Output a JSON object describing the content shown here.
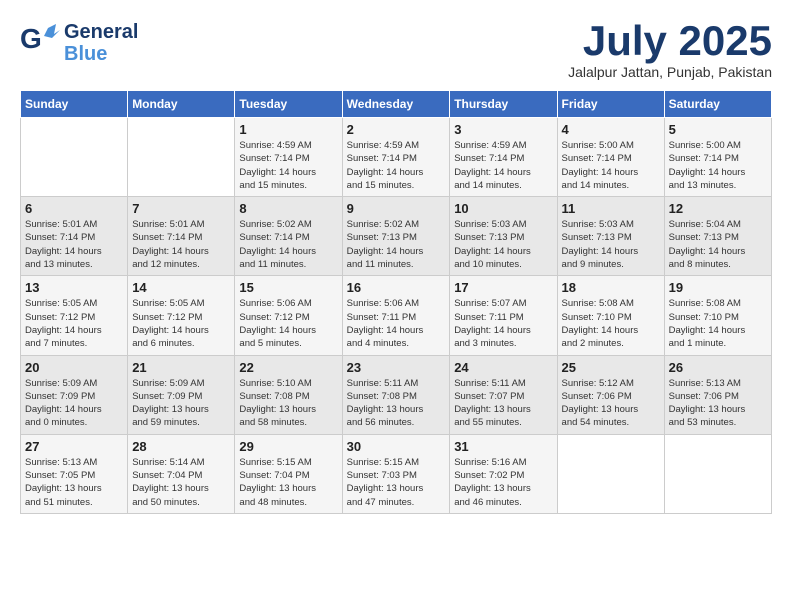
{
  "header": {
    "logo_general": "General",
    "logo_blue": "Blue",
    "month_title": "July 2025",
    "location": "Jalalpur Jattan, Punjab, Pakistan"
  },
  "weekdays": [
    "Sunday",
    "Monday",
    "Tuesday",
    "Wednesday",
    "Thursday",
    "Friday",
    "Saturday"
  ],
  "weeks": [
    [
      {
        "day": "",
        "info": ""
      },
      {
        "day": "",
        "info": ""
      },
      {
        "day": "1",
        "info": "Sunrise: 4:59 AM\nSunset: 7:14 PM\nDaylight: 14 hours\nand 15 minutes."
      },
      {
        "day": "2",
        "info": "Sunrise: 4:59 AM\nSunset: 7:14 PM\nDaylight: 14 hours\nand 15 minutes."
      },
      {
        "day": "3",
        "info": "Sunrise: 4:59 AM\nSunset: 7:14 PM\nDaylight: 14 hours\nand 14 minutes."
      },
      {
        "day": "4",
        "info": "Sunrise: 5:00 AM\nSunset: 7:14 PM\nDaylight: 14 hours\nand 14 minutes."
      },
      {
        "day": "5",
        "info": "Sunrise: 5:00 AM\nSunset: 7:14 PM\nDaylight: 14 hours\nand 13 minutes."
      }
    ],
    [
      {
        "day": "6",
        "info": "Sunrise: 5:01 AM\nSunset: 7:14 PM\nDaylight: 14 hours\nand 13 minutes."
      },
      {
        "day": "7",
        "info": "Sunrise: 5:01 AM\nSunset: 7:14 PM\nDaylight: 14 hours\nand 12 minutes."
      },
      {
        "day": "8",
        "info": "Sunrise: 5:02 AM\nSunset: 7:14 PM\nDaylight: 14 hours\nand 11 minutes."
      },
      {
        "day": "9",
        "info": "Sunrise: 5:02 AM\nSunset: 7:13 PM\nDaylight: 14 hours\nand 11 minutes."
      },
      {
        "day": "10",
        "info": "Sunrise: 5:03 AM\nSunset: 7:13 PM\nDaylight: 14 hours\nand 10 minutes."
      },
      {
        "day": "11",
        "info": "Sunrise: 5:03 AM\nSunset: 7:13 PM\nDaylight: 14 hours\nand 9 minutes."
      },
      {
        "day": "12",
        "info": "Sunrise: 5:04 AM\nSunset: 7:13 PM\nDaylight: 14 hours\nand 8 minutes."
      }
    ],
    [
      {
        "day": "13",
        "info": "Sunrise: 5:05 AM\nSunset: 7:12 PM\nDaylight: 14 hours\nand 7 minutes."
      },
      {
        "day": "14",
        "info": "Sunrise: 5:05 AM\nSunset: 7:12 PM\nDaylight: 14 hours\nand 6 minutes."
      },
      {
        "day": "15",
        "info": "Sunrise: 5:06 AM\nSunset: 7:12 PM\nDaylight: 14 hours\nand 5 minutes."
      },
      {
        "day": "16",
        "info": "Sunrise: 5:06 AM\nSunset: 7:11 PM\nDaylight: 14 hours\nand 4 minutes."
      },
      {
        "day": "17",
        "info": "Sunrise: 5:07 AM\nSunset: 7:11 PM\nDaylight: 14 hours\nand 3 minutes."
      },
      {
        "day": "18",
        "info": "Sunrise: 5:08 AM\nSunset: 7:10 PM\nDaylight: 14 hours\nand 2 minutes."
      },
      {
        "day": "19",
        "info": "Sunrise: 5:08 AM\nSunset: 7:10 PM\nDaylight: 14 hours\nand 1 minute."
      }
    ],
    [
      {
        "day": "20",
        "info": "Sunrise: 5:09 AM\nSunset: 7:09 PM\nDaylight: 14 hours\nand 0 minutes."
      },
      {
        "day": "21",
        "info": "Sunrise: 5:09 AM\nSunset: 7:09 PM\nDaylight: 13 hours\nand 59 minutes."
      },
      {
        "day": "22",
        "info": "Sunrise: 5:10 AM\nSunset: 7:08 PM\nDaylight: 13 hours\nand 58 minutes."
      },
      {
        "day": "23",
        "info": "Sunrise: 5:11 AM\nSunset: 7:08 PM\nDaylight: 13 hours\nand 56 minutes."
      },
      {
        "day": "24",
        "info": "Sunrise: 5:11 AM\nSunset: 7:07 PM\nDaylight: 13 hours\nand 55 minutes."
      },
      {
        "day": "25",
        "info": "Sunrise: 5:12 AM\nSunset: 7:06 PM\nDaylight: 13 hours\nand 54 minutes."
      },
      {
        "day": "26",
        "info": "Sunrise: 5:13 AM\nSunset: 7:06 PM\nDaylight: 13 hours\nand 53 minutes."
      }
    ],
    [
      {
        "day": "27",
        "info": "Sunrise: 5:13 AM\nSunset: 7:05 PM\nDaylight: 13 hours\nand 51 minutes."
      },
      {
        "day": "28",
        "info": "Sunrise: 5:14 AM\nSunset: 7:04 PM\nDaylight: 13 hours\nand 50 minutes."
      },
      {
        "day": "29",
        "info": "Sunrise: 5:15 AM\nSunset: 7:04 PM\nDaylight: 13 hours\nand 48 minutes."
      },
      {
        "day": "30",
        "info": "Sunrise: 5:15 AM\nSunset: 7:03 PM\nDaylight: 13 hours\nand 47 minutes."
      },
      {
        "day": "31",
        "info": "Sunrise: 5:16 AM\nSunset: 7:02 PM\nDaylight: 13 hours\nand 46 minutes."
      },
      {
        "day": "",
        "info": ""
      },
      {
        "day": "",
        "info": ""
      }
    ]
  ]
}
